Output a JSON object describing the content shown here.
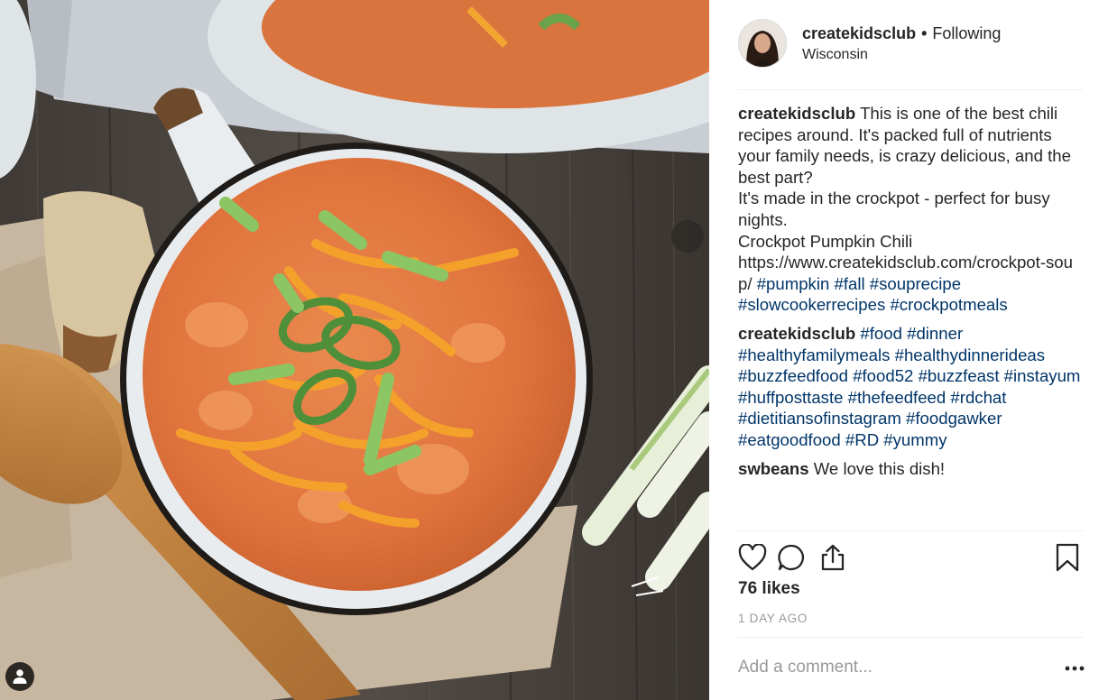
{
  "post": {
    "image_alt": "Bowl of pumpkin chili topped with cheddar and green onions",
    "tagged_people_icon": "person-icon"
  },
  "header": {
    "username": "createkidsclub",
    "separator": "•",
    "follow_status": "Following",
    "location": "Wisconsin"
  },
  "caption": {
    "username": "createkidsclub",
    "para1": "This is one of the best chili recipes around. It's packed full of nutrients your family needs, is crazy delicious, and the best part?",
    "para2": "It's made in the crockpot - perfect for busy nights.",
    "para3_title": "Crockpot Pumpkin Chili",
    "link": "https://www.createkidsclub.com/crockpot-soup/",
    "hashtags": [
      "#pumpkin",
      "#fall",
      "#souprecipe",
      "#slowcookerrecipes",
      "#crockpotmeals"
    ]
  },
  "comments": [
    {
      "username": "createkidsclub",
      "text": "",
      "hashtags": [
        "#food",
        "#dinner",
        "#healthyfamilymeals",
        "#healthydinnerideas",
        "#buzzfeedfood",
        "#food52",
        "#buzzfeast",
        "#instayum",
        "#huffposttaste",
        "#thefeedfeed",
        "#rdchat",
        "#dietitiansofinstagram",
        "#foodgawker",
        "#eatgoodfood",
        "#RD",
        "#yummy"
      ]
    },
    {
      "username": "swbeans",
      "text": "We love this dish!",
      "hashtags": []
    }
  ],
  "actions": {
    "like_icon": "heart-icon",
    "comment_icon": "comment-icon",
    "share_icon": "share-icon",
    "save_icon": "bookmark-icon"
  },
  "likes": "76 likes",
  "timestamp": "1 DAY AGO",
  "add_comment": {
    "placeholder": "Add a comment...",
    "more_icon": "more-icon"
  },
  "colors": {
    "hashtag": "#003569",
    "text": "#262626",
    "muted": "#999999",
    "divider": "#efefef"
  }
}
